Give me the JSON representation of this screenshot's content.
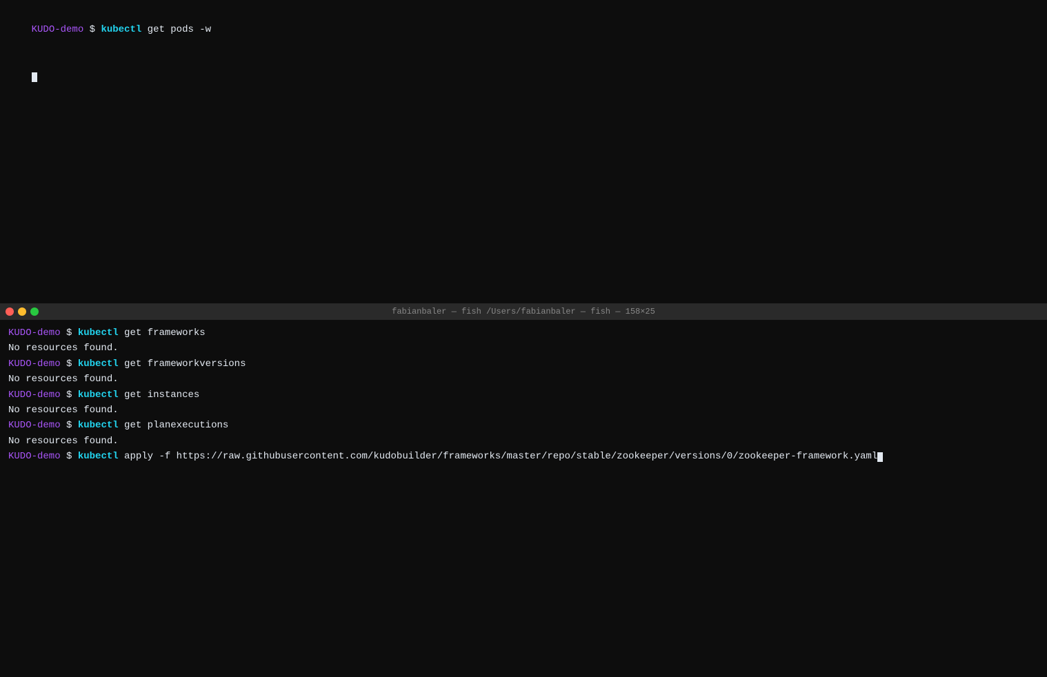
{
  "top_terminal": {
    "line1_prompt": "KUDO-demo",
    "line1_dollar": " $ ",
    "line1_cmd": "kubectl",
    "line1_args": " get pods -w",
    "line2_cursor": true
  },
  "divider": {
    "title": "fabianbaler — fish /Users/fabianbaler — fish — 158×25",
    "dots": [
      "red",
      "yellow",
      "green"
    ]
  },
  "bottom_terminal": {
    "lines": [
      {
        "type": "command",
        "prompt": "KUDO-demo",
        "dollar": " $ ",
        "cmd": "kubectl",
        "args": " get frameworks"
      },
      {
        "type": "output",
        "text": "No resources found."
      },
      {
        "type": "command",
        "prompt": "KUDO-demo",
        "dollar": " $ ",
        "cmd": "kubectl",
        "args": " get frameworkversions"
      },
      {
        "type": "output",
        "text": "No resources found."
      },
      {
        "type": "command",
        "prompt": "KUDO-demo",
        "dollar": " $ ",
        "cmd": "kubectl",
        "args": " get instances"
      },
      {
        "type": "output",
        "text": "No resources found."
      },
      {
        "type": "command",
        "prompt": "KUDO-demo",
        "dollar": " $ ",
        "cmd": "kubectl",
        "args": " get planexecutions"
      },
      {
        "type": "output",
        "text": "No resources found."
      },
      {
        "type": "command_cursor",
        "prompt": "KUDO-demo",
        "dollar": " $ ",
        "cmd": "kubectl",
        "args": " apply -f https://raw.githubusercontent.com/kudobuilder/frameworks/master/repo/stable/zookeeper/versions/0/zookeeper-framework.yaml"
      }
    ]
  }
}
